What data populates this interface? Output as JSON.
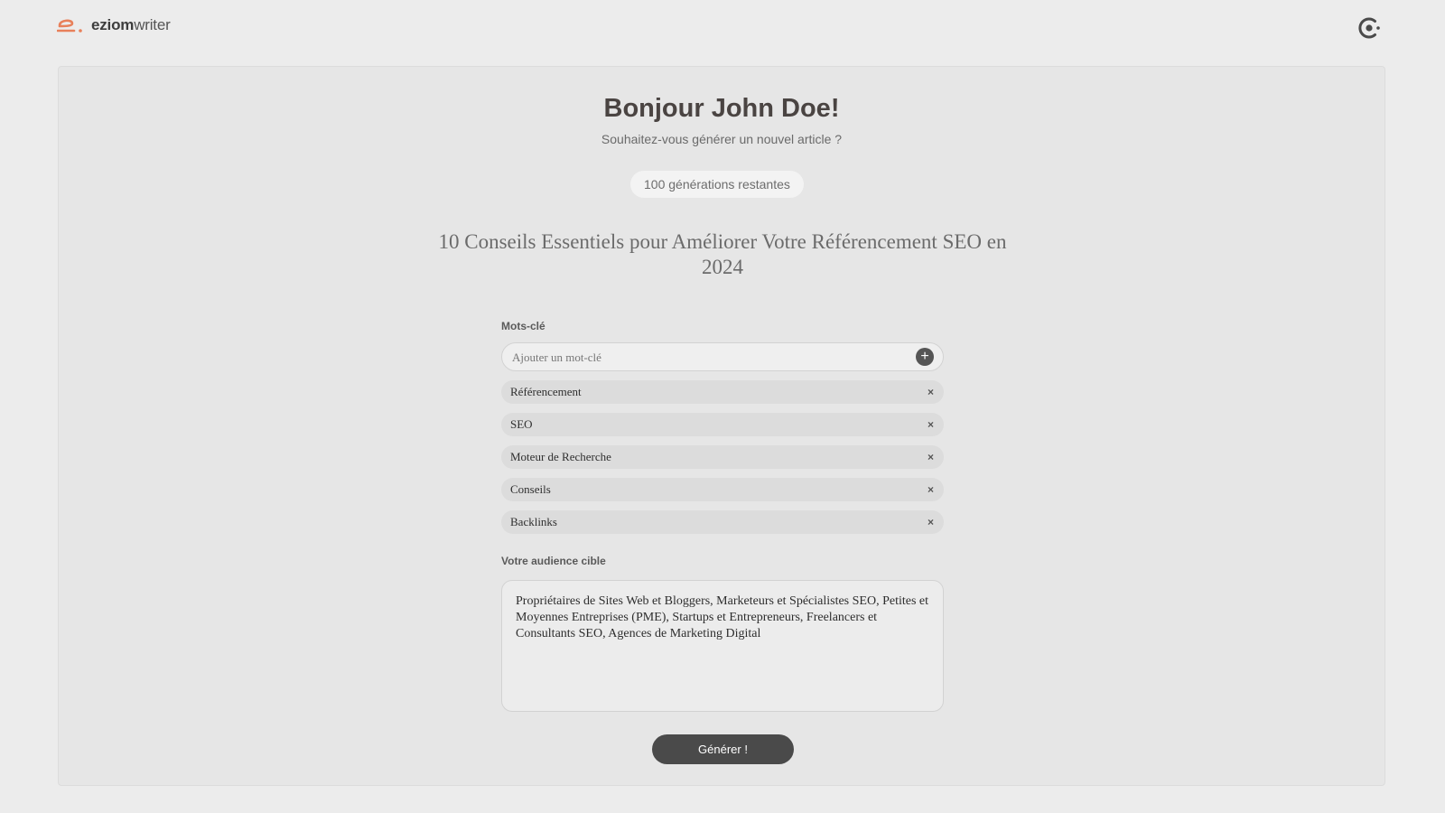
{
  "header": {
    "logo_bold": "eziom",
    "logo_light": "writer",
    "brand_color": "#e8805a",
    "user_icon": "user-refresh-icon"
  },
  "main": {
    "greeting": "Bonjour John Doe!",
    "subtitle": "Souhaitez-vous générer un nouvel article ?",
    "quota": "100 générations restantes",
    "article_title": "10 Conseils Essentiels pour Améliorer Votre Référencement SEO en 2024"
  },
  "keywords": {
    "label": "Mots-clé",
    "placeholder": "Ajouter un mot-clé",
    "value": "",
    "add_icon": "plus-icon",
    "remove_symbol": "×",
    "items": [
      {
        "label": "Référencement"
      },
      {
        "label": "SEO"
      },
      {
        "label": "Moteur de Recherche"
      },
      {
        "label": "Conseils"
      },
      {
        "label": "Backlinks"
      }
    ]
  },
  "audience": {
    "label": "Votre audience cible",
    "value": "Propriétaires de Sites Web et Bloggers, Marketeurs et Spécialistes SEO, Petites et Moyennes Entreprises (PME), Startups et Entrepreneurs, Freelancers et Consultants SEO, Agences de Marketing Digital"
  },
  "actions": {
    "generate_label": "Générer !"
  }
}
